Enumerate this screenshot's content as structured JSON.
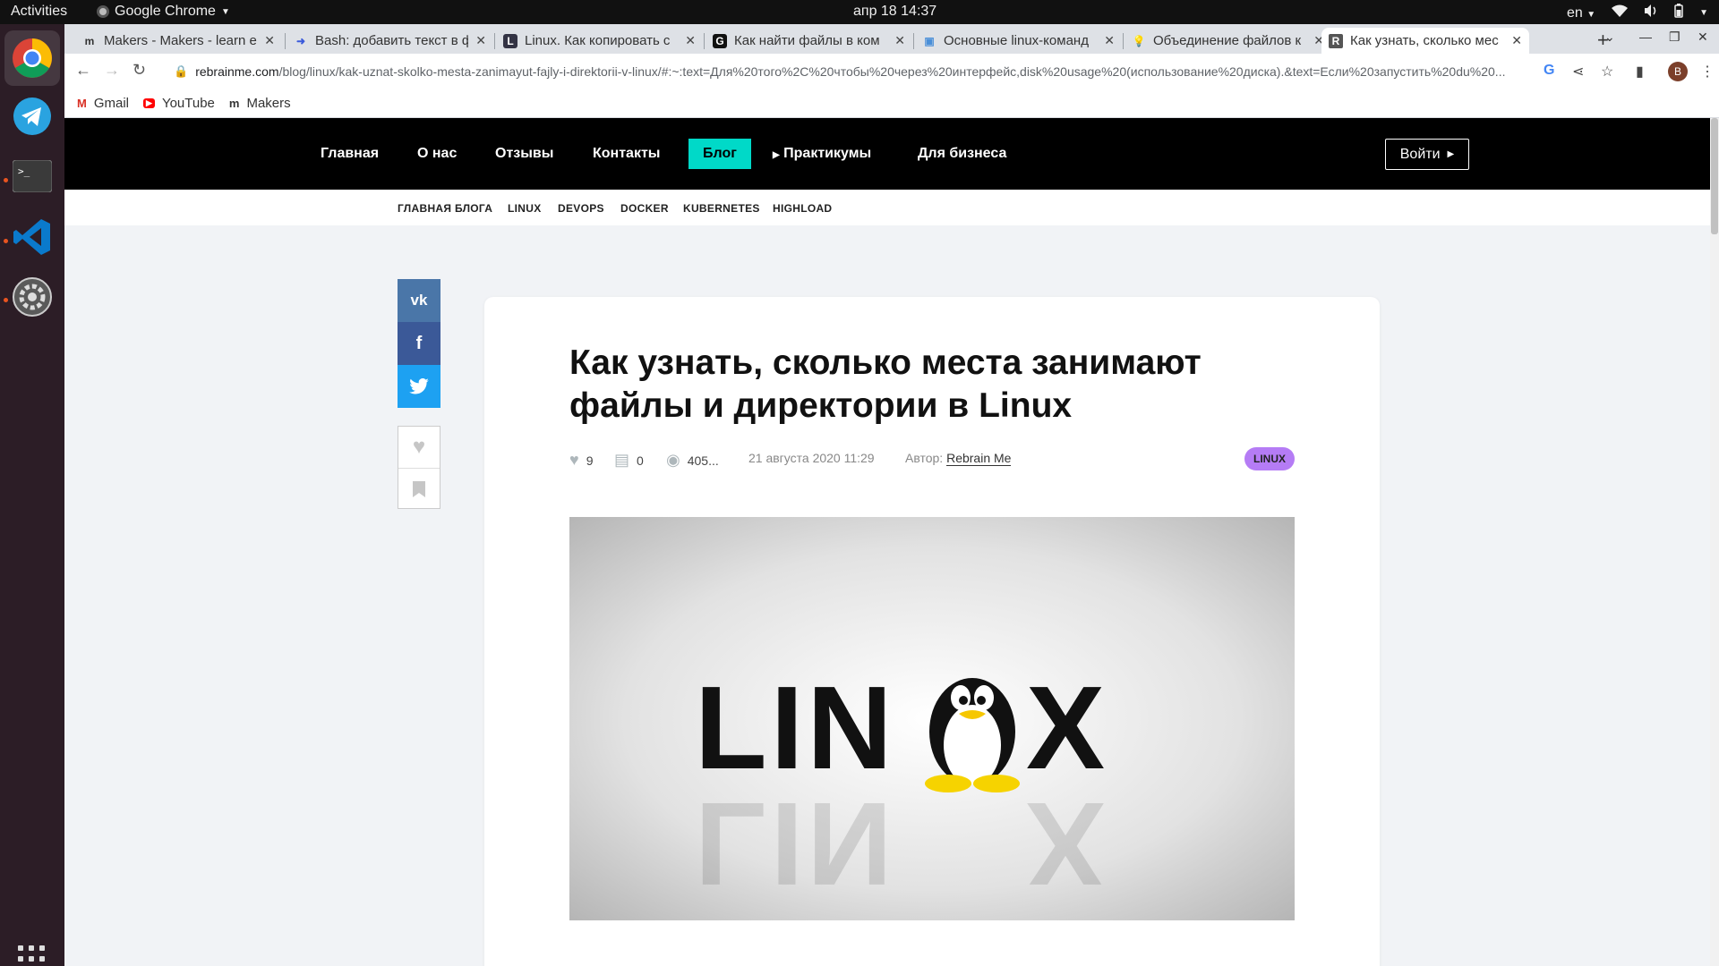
{
  "system": {
    "activities": "Activities",
    "app_name": "Google Chrome",
    "clock": "апр 18  14:37",
    "lang": "en"
  },
  "tabs": [
    {
      "favicon": "m",
      "title": "Makers - Makers - learn e",
      "active": false
    },
    {
      "favicon": "➜",
      "title": "Bash: добавить текст в ф",
      "active": false
    },
    {
      "favicon": "L",
      "title": "Linux. Как копировать с",
      "active": false
    },
    {
      "favicon": "G",
      "title": "Как найти файлы в ком",
      "active": false
    },
    {
      "favicon": "▣",
      "title": "Основные linux-команд",
      "active": false
    },
    {
      "favicon": "💡",
      "title": "Объединение файлов к",
      "active": false
    },
    {
      "favicon": "R",
      "title": "Как узнать, сколько мес",
      "active": true
    }
  ],
  "toolbar": {
    "url_host": "rebrainme.com",
    "url_path": "/blog/linux/kak-uznat-skolko-mesta-zanimayut-fajly-i-direktorii-v-linux/#:~:text=Для%20того%2C%20чтобы%20через%20интерфейс,disk%20usage%20(использование%20диска).&text=Если%20запустить%20du%20...",
    "profile_initial": "B"
  },
  "bookmarks": [
    {
      "icon": "M",
      "label": "Gmail"
    },
    {
      "icon": "▶",
      "label": "YouTube"
    },
    {
      "icon": "m",
      "label": "Makers"
    }
  ],
  "site_nav": {
    "items": [
      "Главная",
      "О нас",
      "Отзывы",
      "Контакты",
      "Блог",
      "Практикумы",
      "Для бизнеса"
    ],
    "active": "Блог",
    "login": "Войти"
  },
  "sub_nav": [
    "ГЛАВНАЯ БЛОГА",
    "LINUX",
    "DEVOPS",
    "DOCKER",
    "KUBERNETES",
    "HIGHLOAD"
  ],
  "share": {
    "vk": "vk",
    "facebook": "f",
    "twitter": "🐦"
  },
  "article": {
    "title": "Как узнать, сколько места занимают файлы и директории в Linux",
    "likes": "9",
    "comments": "0",
    "views": "405...",
    "date": "21 августа 2020 11:29",
    "author_label": "Автор:",
    "author": "Rebrain Me",
    "tag": "LINUX",
    "hero_text_left": "LIN",
    "hero_text_right": "X"
  },
  "colors": {
    "accent": "#00d9c8",
    "tag_bg": "#b57cf5",
    "vk": "#4a76a8",
    "facebook": "#3b5998",
    "twitter": "#1da1f2"
  }
}
